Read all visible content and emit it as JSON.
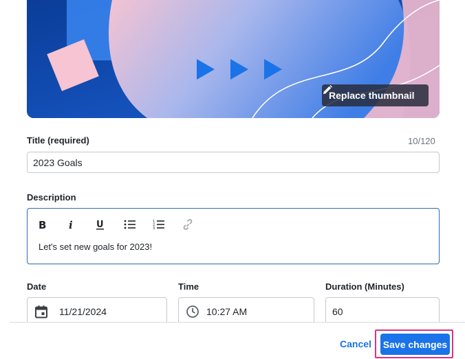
{
  "thumbnail": {
    "replace_label": "Replace thumbnail"
  },
  "title_field": {
    "label": "Title (required)",
    "counter": "10/120",
    "value": "2023 Goals"
  },
  "description_field": {
    "label": "Description",
    "toolbar": [
      "bold-icon",
      "italic-icon",
      "underline-icon",
      "bulleted-list-icon",
      "numbered-list-icon",
      "link-icon"
    ],
    "value": "Let's set new goals for 2023!"
  },
  "date_field": {
    "label": "Date",
    "value": "11/21/2024"
  },
  "time_field": {
    "label": "Time",
    "value": "10:27 AM"
  },
  "duration_field": {
    "label": "Duration (Minutes)",
    "value": "60"
  },
  "footer": {
    "cancel_label": "Cancel",
    "save_label": "Save changes"
  },
  "colors": {
    "primary": "#1a73e8",
    "highlight": "#d63384"
  }
}
